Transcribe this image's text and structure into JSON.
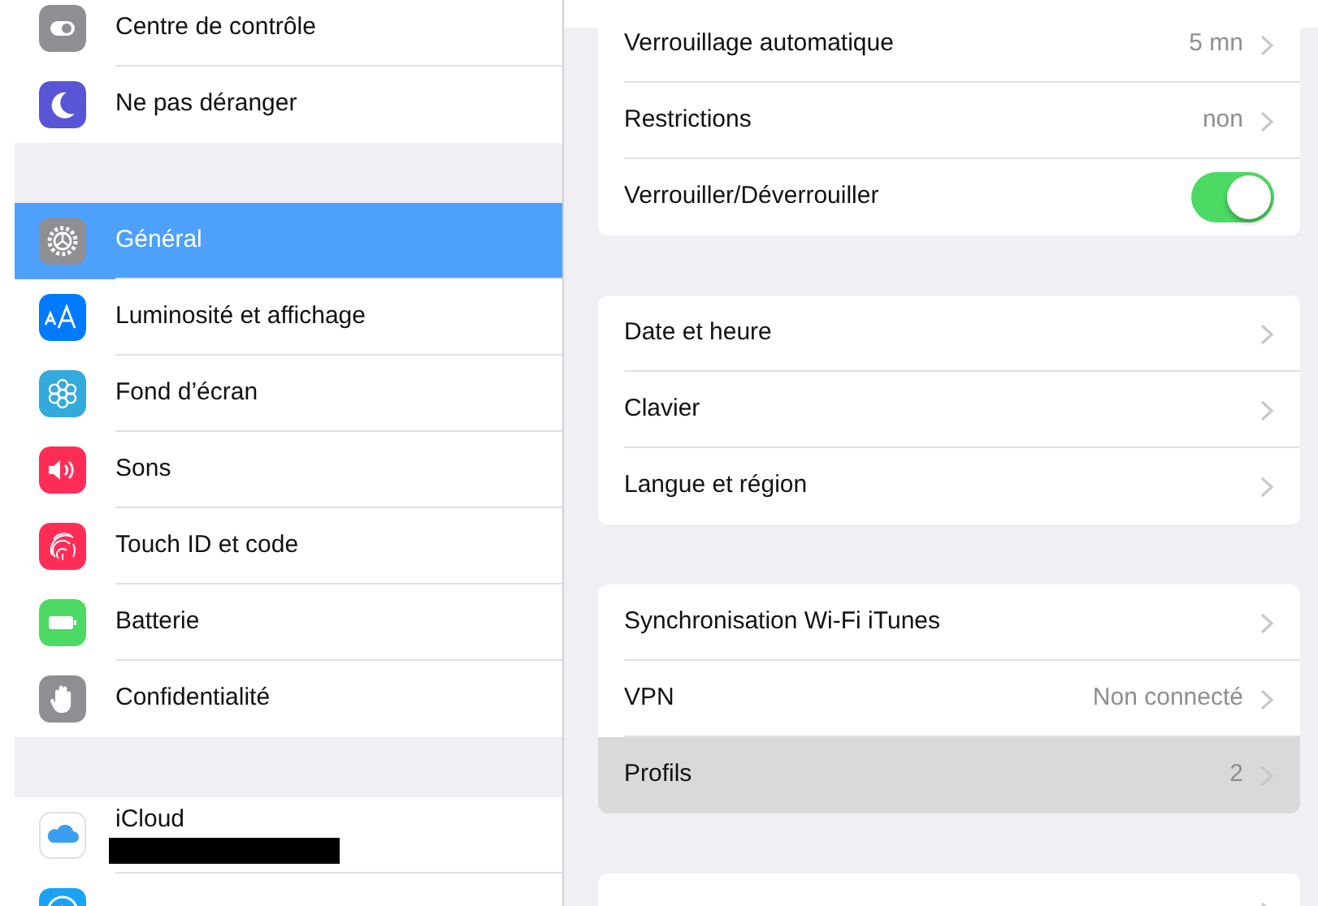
{
  "sidebar": {
    "groups": [
      {
        "items": [
          {
            "label": "Centre de contrôle",
            "selected": false
          },
          {
            "label": "Ne pas déranger",
            "selected": false
          }
        ]
      },
      {
        "items": [
          {
            "label": "Général",
            "selected": true
          },
          {
            "label": "Luminosité et affichage",
            "selected": false
          },
          {
            "label": "Fond d’écran",
            "selected": false
          },
          {
            "label": "Sons",
            "selected": false
          },
          {
            "label": "Touch ID et code",
            "selected": false
          },
          {
            "label": "Batterie",
            "selected": false
          },
          {
            "label": "Confidentialité",
            "selected": false
          }
        ]
      },
      {
        "items": [
          {
            "label": "iCloud",
            "selected": false,
            "subtitle_redacted": true
          },
          {
            "selected": false
          }
        ]
      }
    ]
  },
  "detail": {
    "sections": [
      {
        "rows": [
          {
            "kind": "link",
            "label": "Verrouillage automatique",
            "value": "5 mn",
            "selected": false
          },
          {
            "kind": "link",
            "label": "Restrictions",
            "value": "non",
            "selected": false
          },
          {
            "kind": "toggle",
            "label": "Verrouiller/Déverrouiller",
            "on": true,
            "selected": false
          }
        ]
      },
      {
        "rows": [
          {
            "kind": "link",
            "label": "Date et heure",
            "selected": false
          },
          {
            "kind": "link",
            "label": "Clavier",
            "selected": false
          },
          {
            "kind": "link",
            "label": "Langue et région",
            "selected": false
          }
        ]
      },
      {
        "rows": [
          {
            "kind": "link",
            "label": "Synchronisation Wi-Fi iTunes",
            "selected": false
          },
          {
            "kind": "link",
            "label": "VPN",
            "value": "Non connecté",
            "selected": false
          },
          {
            "kind": "link",
            "label": "Profils",
            "value": "2",
            "selected": true
          }
        ]
      },
      {
        "rows": [
          {
            "kind": "link",
            "selected": false
          }
        ]
      }
    ]
  }
}
